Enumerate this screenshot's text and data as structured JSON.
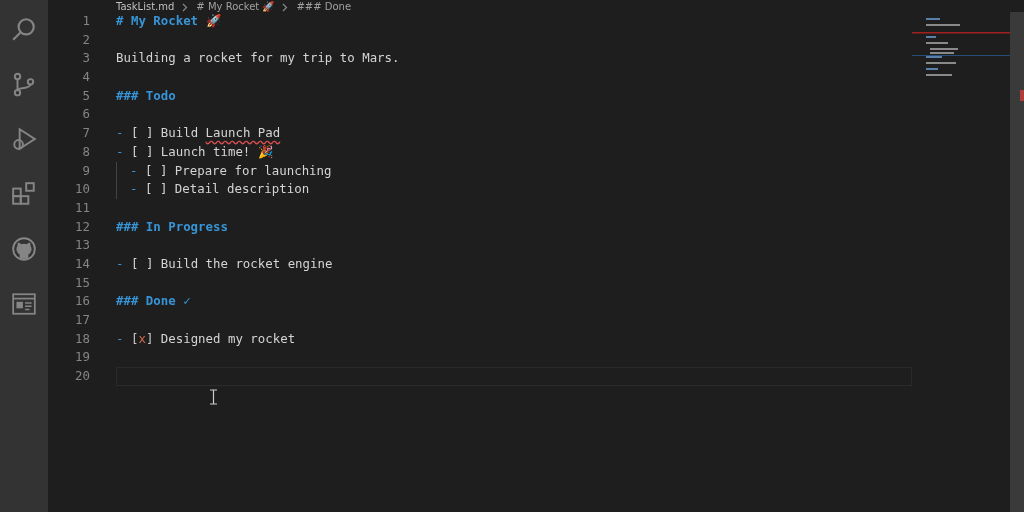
{
  "breadcrumb": [
    {
      "text": "TaskList.md",
      "kind": "file"
    },
    {
      "text": "# My Rocket 🚀",
      "kind": "section"
    },
    {
      "text": "### Done",
      "kind": "section"
    }
  ],
  "activity_bar": [
    {
      "kind": "search"
    },
    {
      "kind": "source-control"
    },
    {
      "kind": "run-debug"
    },
    {
      "kind": "extensions"
    },
    {
      "kind": "github"
    },
    {
      "kind": "preview"
    }
  ],
  "lines": [
    {
      "number": "1",
      "kind": "heading",
      "text": "# My Rocket 🚀"
    },
    {
      "number": "2",
      "kind": "blank"
    },
    {
      "number": "3",
      "kind": "paragraph",
      "text": "Building a rocket for my trip to Mars."
    },
    {
      "number": "4",
      "kind": "blank"
    },
    {
      "number": "5",
      "kind": "heading",
      "text": "### Todo"
    },
    {
      "number": "6",
      "kind": "blank"
    },
    {
      "number": "7",
      "kind": "task",
      "marker": "-",
      "box": "[ ]",
      "checked": false,
      "text": "Build",
      "flagged_text": "Launch Pad"
    },
    {
      "number": "8",
      "kind": "task",
      "marker": "-",
      "box": "[ ]",
      "checked": false,
      "text": "Launch time! 🎉",
      "children": [
        {
          "number": "9",
          "kind": "task",
          "marker": "-",
          "box": "[ ]",
          "checked": false,
          "text": "Prepare for launching"
        },
        {
          "number": "10",
          "kind": "task",
          "marker": "-",
          "box": "[ ]",
          "checked": false,
          "text": "Detail description"
        }
      ]
    },
    {
      "number": "11",
      "kind": "blank"
    },
    {
      "number": "12",
      "kind": "heading",
      "text": "### In Progress"
    },
    {
      "number": "13",
      "kind": "blank"
    },
    {
      "number": "14",
      "kind": "task",
      "marker": "-",
      "box": "[ ]",
      "checked": false,
      "text": "Build the rocket engine"
    },
    {
      "number": "15",
      "kind": "blank"
    },
    {
      "number": "16",
      "kind": "heading",
      "text": "### Done ✓"
    },
    {
      "number": "17",
      "kind": "blank"
    },
    {
      "number": "18",
      "kind": "task",
      "marker": "-",
      "box": "[x]",
      "checked": true,
      "text": "Designed my rocket"
    },
    {
      "number": "19",
      "kind": "blank"
    },
    {
      "number": "20",
      "kind": "blank",
      "current": true
    }
  ]
}
